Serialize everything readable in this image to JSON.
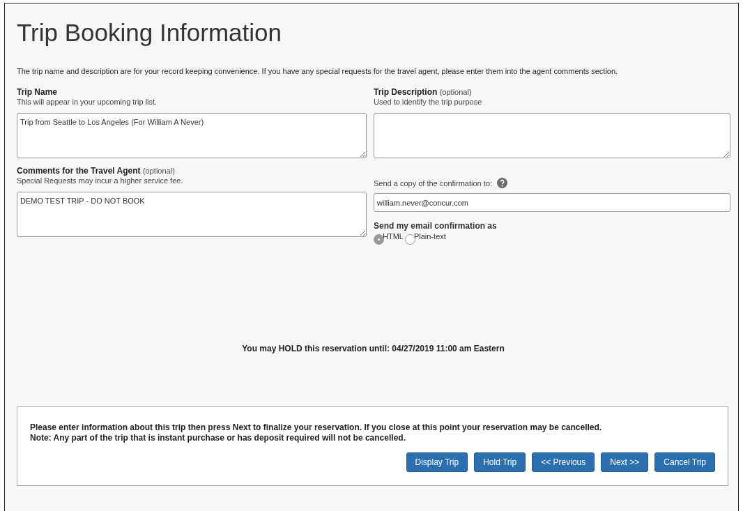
{
  "title": "Trip Booking Information",
  "intro": "The trip name and description are for your record keeping convenience. If you have any special requests for the travel agent, please enter them into the agent comments section.",
  "trip_name": {
    "label": "Trip Name",
    "hint": "This will appear in your upcoming trip list.",
    "value": "Trip from Seattle to Los Angeles (For William A Never)"
  },
  "trip_description": {
    "label": "Trip Description",
    "optional": "(optional)",
    "hint": "Used to identify the trip purpose"
  },
  "comments": {
    "label": "Comments for the Travel Agent",
    "optional": "(optional)",
    "hint": "Special Requests may incur a higher service fee.",
    "value": "DEMO TEST TRIP - DO NOT BOOK"
  },
  "confirmation_copy": {
    "label": "Send a copy of the confirmation to:",
    "value": "william.never@concur.com"
  },
  "email_format": {
    "label": "Send my email confirmation as",
    "options": [
      {
        "label": "HTML",
        "selected": true
      },
      {
        "label": "Plain-text",
        "selected": false
      }
    ]
  },
  "hold_notice": "You may HOLD this reservation until: 04/27/2019 11:00 am Eastern",
  "footer": {
    "lines": [
      "Please enter information about this trip then press Next to finalize your reservation. If you close at this point your reservation may be cancelled.",
      "Note: Any part of the trip that is instant purchase or has deposit required will not be cancelled."
    ],
    "buttons": [
      "Display Trip",
      "Hold Trip",
      "<< Previous",
      "Next >>",
      "Cancel Trip"
    ]
  }
}
